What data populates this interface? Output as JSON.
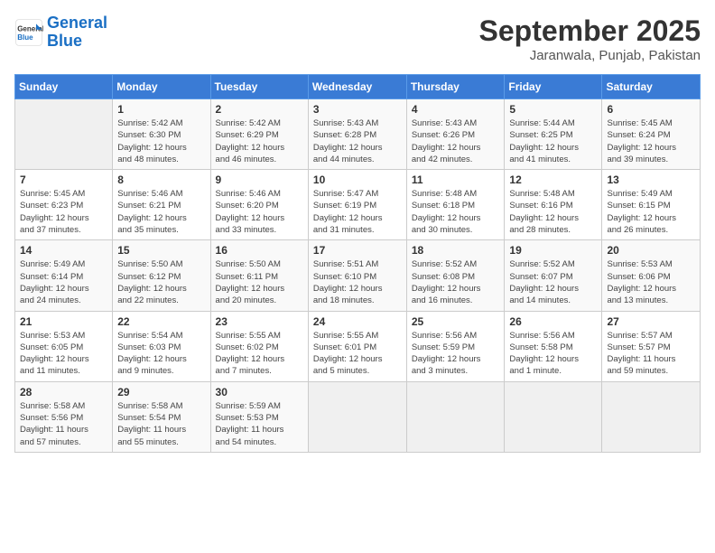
{
  "logo": {
    "line1": "General",
    "line2": "Blue"
  },
  "title": "September 2025",
  "subtitle": "Jaranwala, Punjab, Pakistan",
  "weekdays": [
    "Sunday",
    "Monday",
    "Tuesday",
    "Wednesday",
    "Thursday",
    "Friday",
    "Saturday"
  ],
  "weeks": [
    [
      {
        "day": "",
        "info": ""
      },
      {
        "day": "1",
        "info": "Sunrise: 5:42 AM\nSunset: 6:30 PM\nDaylight: 12 hours\nand 48 minutes."
      },
      {
        "day": "2",
        "info": "Sunrise: 5:42 AM\nSunset: 6:29 PM\nDaylight: 12 hours\nand 46 minutes."
      },
      {
        "day": "3",
        "info": "Sunrise: 5:43 AM\nSunset: 6:28 PM\nDaylight: 12 hours\nand 44 minutes."
      },
      {
        "day": "4",
        "info": "Sunrise: 5:43 AM\nSunset: 6:26 PM\nDaylight: 12 hours\nand 42 minutes."
      },
      {
        "day": "5",
        "info": "Sunrise: 5:44 AM\nSunset: 6:25 PM\nDaylight: 12 hours\nand 41 minutes."
      },
      {
        "day": "6",
        "info": "Sunrise: 5:45 AM\nSunset: 6:24 PM\nDaylight: 12 hours\nand 39 minutes."
      }
    ],
    [
      {
        "day": "7",
        "info": "Sunrise: 5:45 AM\nSunset: 6:23 PM\nDaylight: 12 hours\nand 37 minutes."
      },
      {
        "day": "8",
        "info": "Sunrise: 5:46 AM\nSunset: 6:21 PM\nDaylight: 12 hours\nand 35 minutes."
      },
      {
        "day": "9",
        "info": "Sunrise: 5:46 AM\nSunset: 6:20 PM\nDaylight: 12 hours\nand 33 minutes."
      },
      {
        "day": "10",
        "info": "Sunrise: 5:47 AM\nSunset: 6:19 PM\nDaylight: 12 hours\nand 31 minutes."
      },
      {
        "day": "11",
        "info": "Sunrise: 5:48 AM\nSunset: 6:18 PM\nDaylight: 12 hours\nand 30 minutes."
      },
      {
        "day": "12",
        "info": "Sunrise: 5:48 AM\nSunset: 6:16 PM\nDaylight: 12 hours\nand 28 minutes."
      },
      {
        "day": "13",
        "info": "Sunrise: 5:49 AM\nSunset: 6:15 PM\nDaylight: 12 hours\nand 26 minutes."
      }
    ],
    [
      {
        "day": "14",
        "info": "Sunrise: 5:49 AM\nSunset: 6:14 PM\nDaylight: 12 hours\nand 24 minutes."
      },
      {
        "day": "15",
        "info": "Sunrise: 5:50 AM\nSunset: 6:12 PM\nDaylight: 12 hours\nand 22 minutes."
      },
      {
        "day": "16",
        "info": "Sunrise: 5:50 AM\nSunset: 6:11 PM\nDaylight: 12 hours\nand 20 minutes."
      },
      {
        "day": "17",
        "info": "Sunrise: 5:51 AM\nSunset: 6:10 PM\nDaylight: 12 hours\nand 18 minutes."
      },
      {
        "day": "18",
        "info": "Sunrise: 5:52 AM\nSunset: 6:08 PM\nDaylight: 12 hours\nand 16 minutes."
      },
      {
        "day": "19",
        "info": "Sunrise: 5:52 AM\nSunset: 6:07 PM\nDaylight: 12 hours\nand 14 minutes."
      },
      {
        "day": "20",
        "info": "Sunrise: 5:53 AM\nSunset: 6:06 PM\nDaylight: 12 hours\nand 13 minutes."
      }
    ],
    [
      {
        "day": "21",
        "info": "Sunrise: 5:53 AM\nSunset: 6:05 PM\nDaylight: 12 hours\nand 11 minutes."
      },
      {
        "day": "22",
        "info": "Sunrise: 5:54 AM\nSunset: 6:03 PM\nDaylight: 12 hours\nand 9 minutes."
      },
      {
        "day": "23",
        "info": "Sunrise: 5:55 AM\nSunset: 6:02 PM\nDaylight: 12 hours\nand 7 minutes."
      },
      {
        "day": "24",
        "info": "Sunrise: 5:55 AM\nSunset: 6:01 PM\nDaylight: 12 hours\nand 5 minutes."
      },
      {
        "day": "25",
        "info": "Sunrise: 5:56 AM\nSunset: 5:59 PM\nDaylight: 12 hours\nand 3 minutes."
      },
      {
        "day": "26",
        "info": "Sunrise: 5:56 AM\nSunset: 5:58 PM\nDaylight: 12 hours\nand 1 minute."
      },
      {
        "day": "27",
        "info": "Sunrise: 5:57 AM\nSunset: 5:57 PM\nDaylight: 11 hours\nand 59 minutes."
      }
    ],
    [
      {
        "day": "28",
        "info": "Sunrise: 5:58 AM\nSunset: 5:56 PM\nDaylight: 11 hours\nand 57 minutes."
      },
      {
        "day": "29",
        "info": "Sunrise: 5:58 AM\nSunset: 5:54 PM\nDaylight: 11 hours\nand 55 minutes."
      },
      {
        "day": "30",
        "info": "Sunrise: 5:59 AM\nSunset: 5:53 PM\nDaylight: 11 hours\nand 54 minutes."
      },
      {
        "day": "",
        "info": ""
      },
      {
        "day": "",
        "info": ""
      },
      {
        "day": "",
        "info": ""
      },
      {
        "day": "",
        "info": ""
      }
    ]
  ]
}
